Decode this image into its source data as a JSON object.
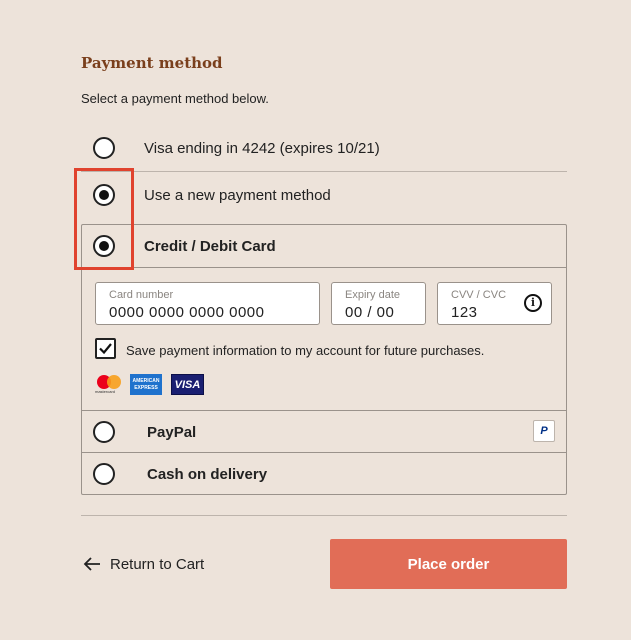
{
  "heading": "Payment method",
  "subheading": "Select a payment method below.",
  "options": {
    "saved_card": {
      "label": "Visa ending in 4242 (expires 10/21)",
      "selected": false
    },
    "new_method": {
      "label": "Use a new payment method",
      "selected": true
    },
    "credit_card": {
      "label": "Credit / Debit Card",
      "selected": true
    },
    "paypal": {
      "label": "PayPal",
      "selected": false
    },
    "cod": {
      "label": "Cash on delivery",
      "selected": false
    }
  },
  "card_form": {
    "card_number": {
      "label": "Card number",
      "value": "0000 0000 0000 0000"
    },
    "expiry": {
      "label": "Expiry date",
      "value": "00 / 00"
    },
    "cvv": {
      "label": "CVV / CVC",
      "value": "123"
    },
    "save_checkbox": {
      "label": "Save payment information to my account for future purchases.",
      "checked": true
    },
    "logos": {
      "mastercard_text": "mastercard",
      "amex_text": "AMERICAN EXPRESS",
      "visa_text": "VISA"
    }
  },
  "paypal_logo_text": "P",
  "footer": {
    "back_label": "Return to Cart",
    "place_order_label": "Place order"
  },
  "colors": {
    "background": "#ede3da",
    "heading": "#7a3f1c",
    "primary_button": "#e16d57",
    "highlight_box": "#e0432e"
  }
}
